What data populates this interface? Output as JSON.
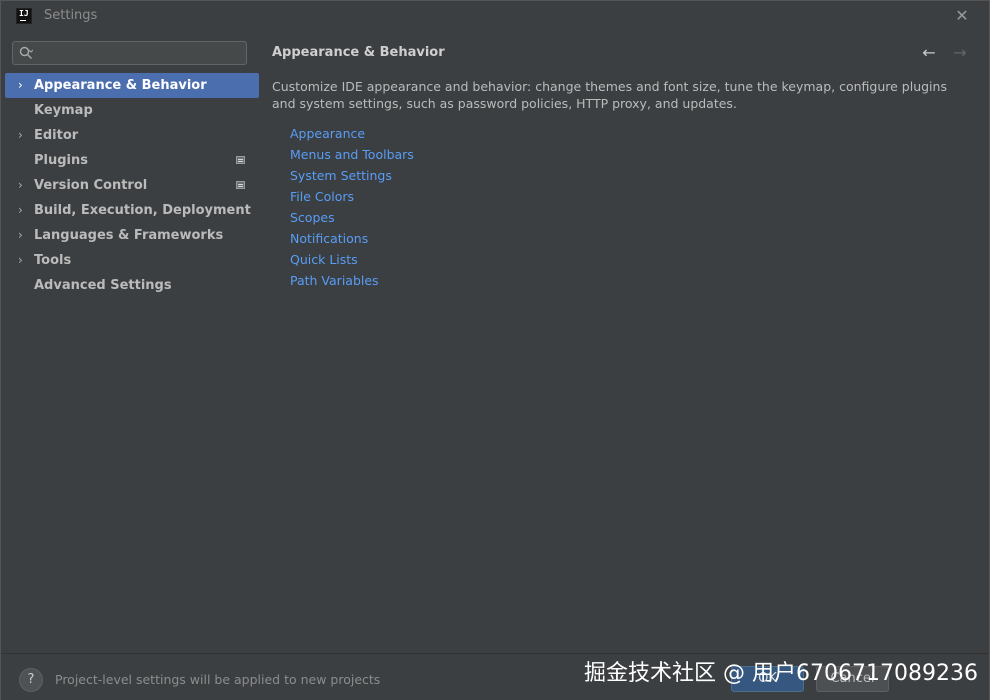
{
  "window": {
    "title": "Settings",
    "app_icon_text": "IJ",
    "close_label": "✕"
  },
  "search": {
    "value": "",
    "placeholder": ""
  },
  "sidebar": {
    "items": [
      {
        "label": "Appearance & Behavior",
        "expandable": true,
        "selected": true,
        "badge": false
      },
      {
        "label": "Keymap",
        "expandable": false,
        "selected": false,
        "badge": false
      },
      {
        "label": "Editor",
        "expandable": true,
        "selected": false,
        "badge": false
      },
      {
        "label": "Plugins",
        "expandable": false,
        "selected": false,
        "badge": true
      },
      {
        "label": "Version Control",
        "expandable": true,
        "selected": false,
        "badge": true
      },
      {
        "label": "Build, Execution, Deployment",
        "expandable": true,
        "selected": false,
        "badge": false
      },
      {
        "label": "Languages & Frameworks",
        "expandable": true,
        "selected": false,
        "badge": false
      },
      {
        "label": "Tools",
        "expandable": true,
        "selected": false,
        "badge": false
      },
      {
        "label": "Advanced Settings",
        "expandable": false,
        "selected": false,
        "badge": false
      }
    ]
  },
  "content": {
    "title": "Appearance & Behavior",
    "back_arrow": "←",
    "forward_arrow": "→",
    "description": "Customize IDE appearance and behavior: change themes and font size, tune the keymap, configure plugins and system settings, such as password policies, HTTP proxy, and updates.",
    "links": [
      "Appearance",
      "Menus and Toolbars",
      "System Settings",
      "File Colors",
      "Scopes",
      "Notifications",
      "Quick Lists",
      "Path Variables"
    ]
  },
  "footer": {
    "help_label": "?",
    "info_text": "Project-level settings will be applied to new projects",
    "ok_label": "OK",
    "cancel_label": "Cancel"
  },
  "watermark": "掘金技术社区 @ 用户6706717089236",
  "colors": {
    "background": "#3c3f41",
    "selection": "#4b6eaf",
    "link": "#589df6",
    "ok_button": "#365880"
  }
}
